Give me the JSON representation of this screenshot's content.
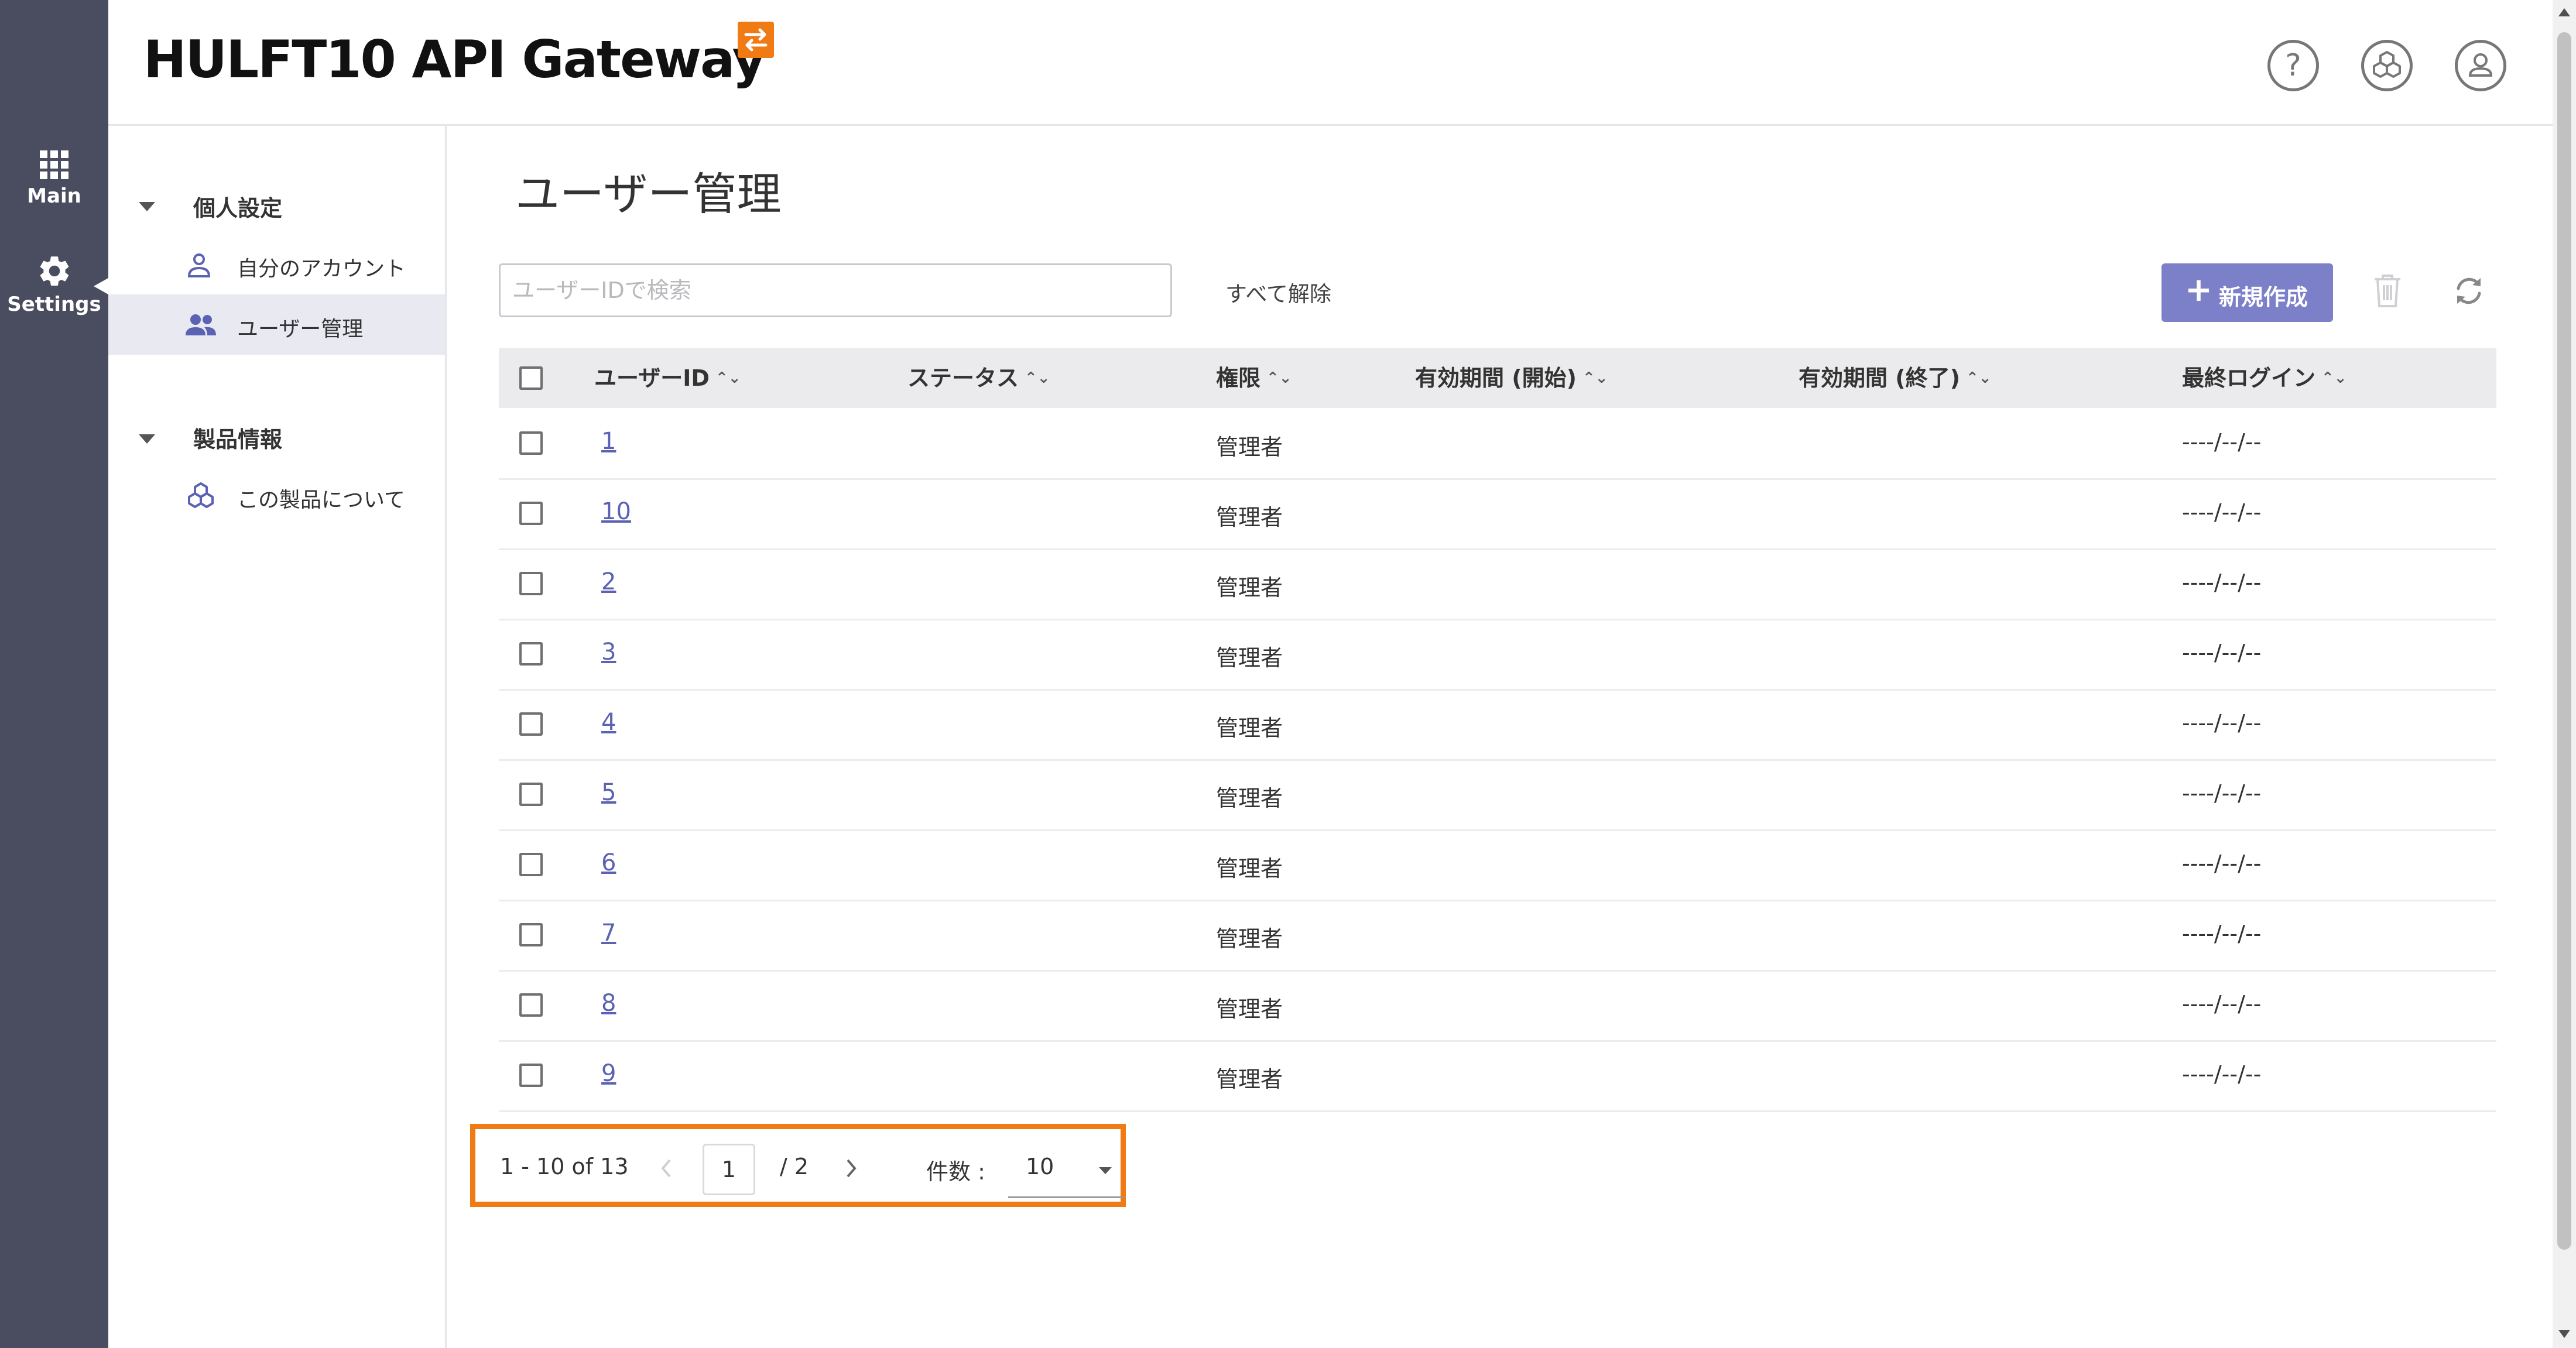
{
  "app": {
    "logo_text": "HULFT10 API Gateway",
    "colors": {
      "rail": "#4a4d60",
      "accent": "#7b80c8",
      "brand": "#f07a14",
      "link": "#5b62b3"
    }
  },
  "rail": {
    "items": [
      {
        "label": "Main",
        "icon": "grid-icon"
      },
      {
        "label": "Settings",
        "icon": "gear-icon"
      }
    ]
  },
  "header": {
    "icons": [
      "help-icon",
      "product-icon",
      "user-account-icon"
    ]
  },
  "tree": {
    "sections": [
      {
        "label": "個人設定",
        "items": [
          {
            "label": "自分のアカウント",
            "icon": "person-icon"
          },
          {
            "label": "ユーザー管理",
            "icon": "people-icon",
            "active": true
          }
        ]
      },
      {
        "label": "製品情報",
        "items": [
          {
            "label": "この製品について",
            "icon": "cubes-icon"
          }
        ]
      }
    ]
  },
  "main": {
    "title": "ユーザー管理",
    "search": {
      "placeholder": "ユーザーIDで検索",
      "value": ""
    },
    "clear_all_label": "すべて解除",
    "new_button_label": "新規作成",
    "new_button_icon": "+"
  },
  "table": {
    "columns": [
      "ユーザーID",
      "ステータス",
      "権限",
      "有効期間 (開始)",
      "有効期間 (終了)",
      "最終ログイン"
    ],
    "sort_glyph": "⌃⌄",
    "rows": [
      {
        "id": "1",
        "status": "",
        "role": "管理者",
        "start": "",
        "end": "",
        "last_login": "----/--/--"
      },
      {
        "id": "10",
        "status": "",
        "role": "管理者",
        "start": "",
        "end": "",
        "last_login": "----/--/--"
      },
      {
        "id": "2",
        "status": "",
        "role": "管理者",
        "start": "",
        "end": "",
        "last_login": "----/--/--"
      },
      {
        "id": "3",
        "status": "",
        "role": "管理者",
        "start": "",
        "end": "",
        "last_login": "----/--/--"
      },
      {
        "id": "4",
        "status": "",
        "role": "管理者",
        "start": "",
        "end": "",
        "last_login": "----/--/--"
      },
      {
        "id": "5",
        "status": "",
        "role": "管理者",
        "start": "",
        "end": "",
        "last_login": "----/--/--"
      },
      {
        "id": "6",
        "status": "",
        "role": "管理者",
        "start": "",
        "end": "",
        "last_login": "----/--/--"
      },
      {
        "id": "7",
        "status": "",
        "role": "管理者",
        "start": "",
        "end": "",
        "last_login": "----/--/--"
      },
      {
        "id": "8",
        "status": "",
        "role": "管理者",
        "start": "",
        "end": "",
        "last_login": "----/--/--"
      },
      {
        "id": "9",
        "status": "",
        "role": "管理者",
        "start": "",
        "end": "",
        "last_login": "----/--/--"
      }
    ]
  },
  "pagination": {
    "range_text": "1 - 10 of 13",
    "current_page": "1",
    "total_pages_text": "/ 2",
    "count_label": "件数 :",
    "page_size": "10"
  }
}
